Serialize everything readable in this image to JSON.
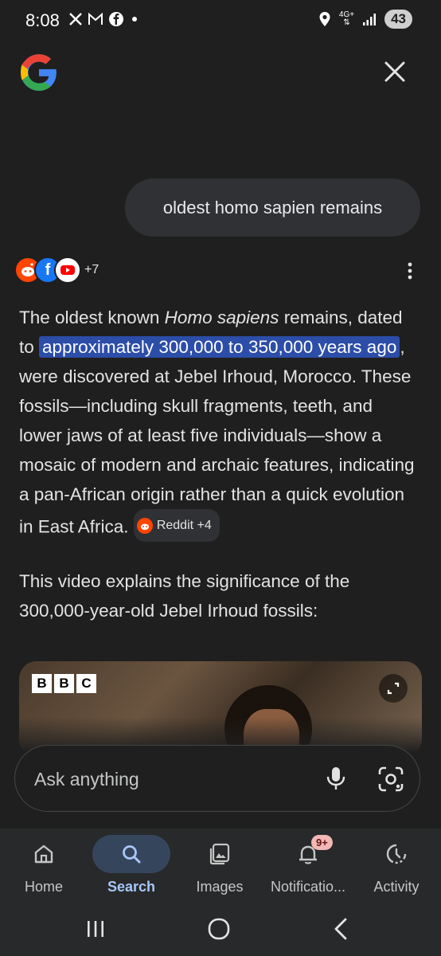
{
  "status_bar": {
    "time": "8:08",
    "network": "4G+",
    "battery": "43"
  },
  "header": {
    "logo": "google-g-logo",
    "close_icon": "close-icon"
  },
  "query": {
    "text": "oldest homo sapien remains"
  },
  "sources": {
    "more_count": "+7"
  },
  "answer": {
    "p1_a": "The oldest known ",
    "p1_italic": "Homo sapiens",
    "p1_b": " remains, dated to ",
    "p1_highlight": "approximately 300,000 to 350,000 years ago",
    "p1_c": ", were discovered at Jebel Irhoud, Morocco. These fossils—including skull fragments, teeth, and lower jaws of at least five individuals—show a mosaic of modern and archaic features, indicating a pan-African origin rather than a quick evolution in East Africa. ",
    "citation_label": "Reddit +4",
    "p2": "This video explains the significance of the 300,000-year-old Jebel Irhoud fossils:"
  },
  "video": {
    "bbc": [
      "B",
      "B",
      "C"
    ]
  },
  "ask_bar": {
    "placeholder": "Ask anything"
  },
  "bottom_nav": {
    "items": [
      {
        "label": "Home",
        "icon": "home-icon"
      },
      {
        "label": "Search",
        "icon": "search-icon"
      },
      {
        "label": "Images",
        "icon": "images-icon"
      },
      {
        "label": "Notificatio...",
        "icon": "bell-icon",
        "badge": "9+"
      },
      {
        "label": "Activity",
        "icon": "activity-icon"
      }
    ]
  },
  "colors": {
    "background": "#1f1f1f",
    "highlight": "#2c4da8",
    "active_nav": "#a8c7fa"
  }
}
